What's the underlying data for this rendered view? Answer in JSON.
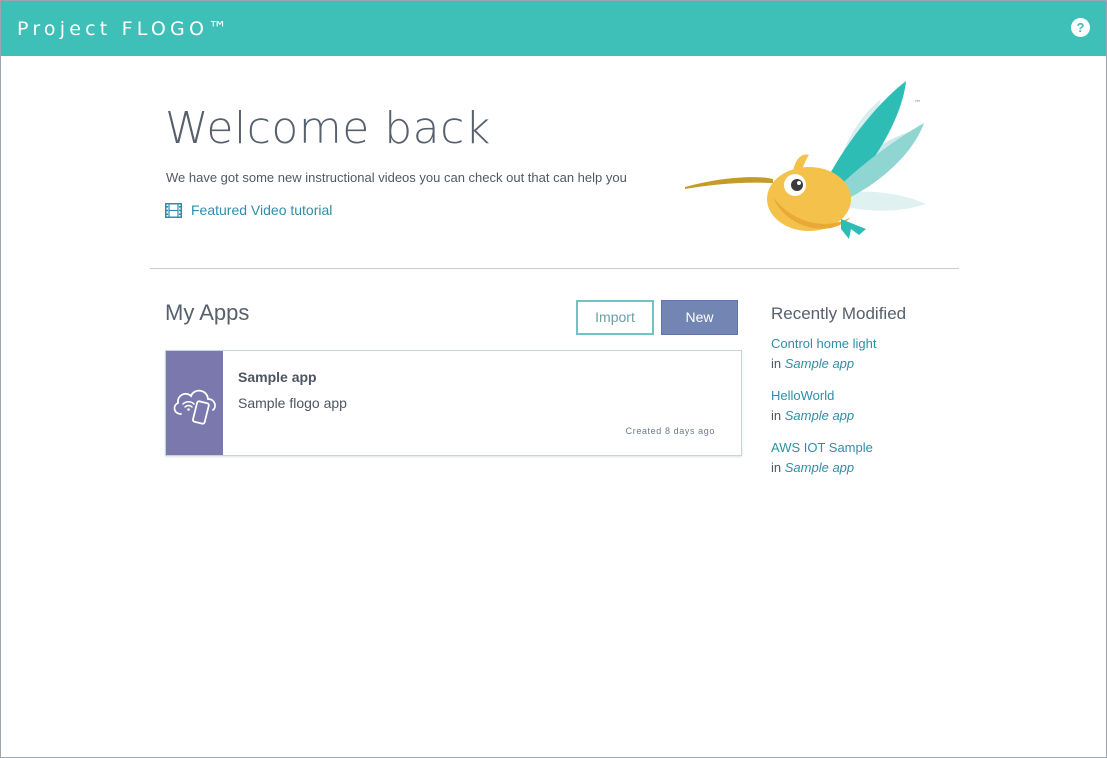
{
  "header": {
    "brand": "Project FLOGO™",
    "help_label": "?"
  },
  "hero": {
    "title": "Welcome back",
    "subtitle": "We have got some new instructional videos you can check out that can help you",
    "video_link_label": "Featured Video tutorial",
    "mascot_tm": "™"
  },
  "apps": {
    "title": "My Apps",
    "import_label": "Import",
    "new_label": "New",
    "items": [
      {
        "name": "Sample app",
        "description": "Sample flogo app",
        "created": "Created 8 days ago"
      }
    ]
  },
  "recent": {
    "title": "Recently Modified",
    "items": [
      {
        "name": "Control home light",
        "in_label": "in",
        "app": "Sample app"
      },
      {
        "name": "HelloWorld",
        "in_label": "in",
        "app": "Sample app"
      },
      {
        "name": "AWS IOT Sample",
        "in_label": "in",
        "app": "Sample app"
      }
    ]
  },
  "icons": {
    "help": "help-circle-icon",
    "video": "film-icon",
    "app_thumb": "cloud-phone-icon",
    "mascot": "hummingbird-logo"
  },
  "colors": {
    "header_bg": "#3ebfb8",
    "accent_link": "#2e8fa8",
    "new_button": "#7385b2",
    "app_thumb_bg": "#7b78ad"
  }
}
